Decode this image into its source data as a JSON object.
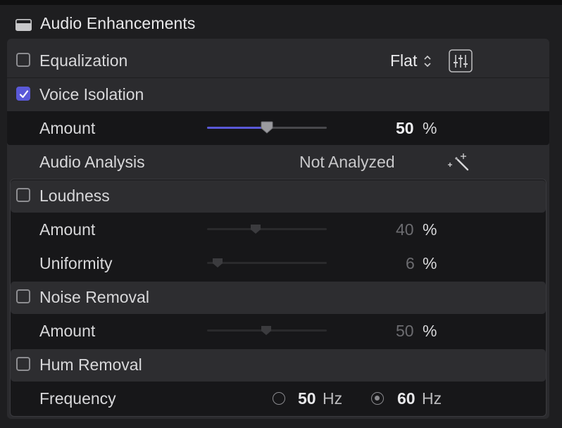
{
  "section": {
    "title": "Audio Enhancements",
    "icon": "panel-icon"
  },
  "equalization": {
    "label": "Equalization",
    "enabled": false,
    "preset": "Flat"
  },
  "voice_isolation": {
    "label": "Voice Isolation",
    "enabled": true,
    "amount_label": "Amount",
    "amount": "50",
    "unit": "%",
    "amount_fraction": 0.5,
    "accent": "#5a59d8"
  },
  "audio_analysis": {
    "label": "Audio Analysis",
    "status": "Not Analyzed"
  },
  "loudness": {
    "label": "Loudness",
    "enabled": false,
    "amount_label": "Amount",
    "amount": "40",
    "unit": "%",
    "uniformity_label": "Uniformity",
    "uniformity": "6"
  },
  "noise_removal": {
    "label": "Noise Removal",
    "enabled": false,
    "amount_label": "Amount",
    "amount": "50",
    "unit": "%"
  },
  "hum_removal": {
    "label": "Hum Removal",
    "enabled": false,
    "frequency_label": "Frequency",
    "options": [
      {
        "value": "50",
        "unit": "Hz",
        "selected": false
      },
      {
        "value": "60",
        "unit": "Hz",
        "selected": true
      }
    ]
  }
}
